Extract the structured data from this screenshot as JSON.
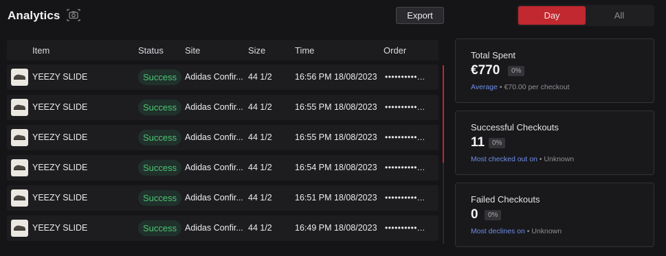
{
  "header": {
    "title": "Analytics",
    "export_label": "Export",
    "toggle": [
      "Day",
      "All"
    ],
    "toggle_active": "Day"
  },
  "table": {
    "columns": [
      "Item",
      "Status",
      "Site",
      "Size",
      "Time",
      "Order"
    ],
    "rows": [
      {
        "item": "YEEZY SLIDE",
        "status": "Success",
        "site": "Adidas Confir...",
        "size": "44 1/2",
        "time": "16:56 PM 18/08/2023",
        "order": "••••••••••..."
      },
      {
        "item": "YEEZY SLIDE",
        "status": "Success",
        "site": "Adidas Confir...",
        "size": "44 1/2",
        "time": "16:55 PM 18/08/2023",
        "order": "••••••••••..."
      },
      {
        "item": "YEEZY SLIDE",
        "status": "Success",
        "site": "Adidas Confir...",
        "size": "44 1/2",
        "time": "16:55 PM 18/08/2023",
        "order": "••••••••••..."
      },
      {
        "item": "YEEZY SLIDE",
        "status": "Success",
        "site": "Adidas Confir...",
        "size": "44 1/2",
        "time": "16:54 PM 18/08/2023",
        "order": "••••••••••..."
      },
      {
        "item": "YEEZY SLIDE",
        "status": "Success",
        "site": "Adidas Confir...",
        "size": "44 1/2",
        "time": "16:51 PM 18/08/2023",
        "order": "••••••••••..."
      },
      {
        "item": "YEEZY SLIDE",
        "status": "Success",
        "site": "Adidas Confir...",
        "size": "44 1/2",
        "time": "16:49 PM 18/08/2023",
        "order": "••••••••••..."
      }
    ]
  },
  "cards": {
    "total_spent": {
      "title": "Total Spent",
      "value": "€770",
      "badge": "0%",
      "link": "Average",
      "sep": " • ",
      "detail": "€70.00 per checkout"
    },
    "successful": {
      "title": "Successful Checkouts",
      "value": "11",
      "badge": "0%",
      "link": "Most checked out on",
      "sep": " • ",
      "detail": "Unknown"
    },
    "failed": {
      "title": "Failed Checkouts",
      "value": "0",
      "badge": "0%",
      "link": "Most declines on",
      "sep": " • ",
      "detail": "Unknown"
    }
  },
  "colors": {
    "accent": "#c2282f",
    "success_text": "#4ec476",
    "link": "#6f8de6"
  },
  "icons": {
    "screenshot": "camera-icon",
    "product": "slide-shoe-icon"
  }
}
